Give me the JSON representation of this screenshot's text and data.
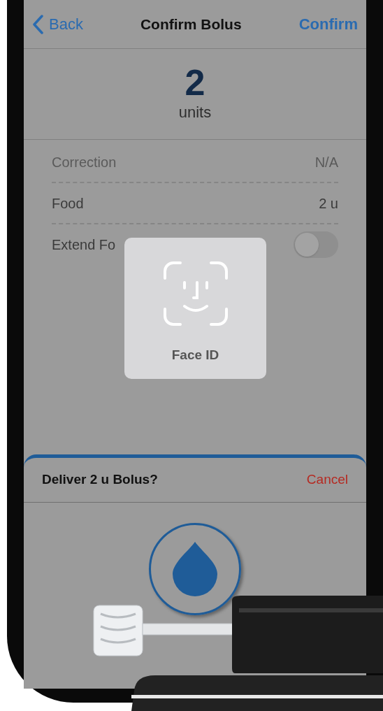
{
  "nav": {
    "back": "Back",
    "title": "Confirm Bolus",
    "action": "Confirm"
  },
  "amount": {
    "value": "2",
    "unit": "units"
  },
  "rows": [
    {
      "kind": "value",
      "label": "Correction",
      "value": "N/A"
    },
    {
      "kind": "value",
      "label": "Food",
      "value": "2 u"
    },
    {
      "kind": "toggle",
      "label": "Extend Fo",
      "on": false
    }
  ],
  "face_id": {
    "label": "Face ID"
  },
  "sheet": {
    "title": "Deliver 2 u Bolus?",
    "cancel": "Cancel"
  }
}
